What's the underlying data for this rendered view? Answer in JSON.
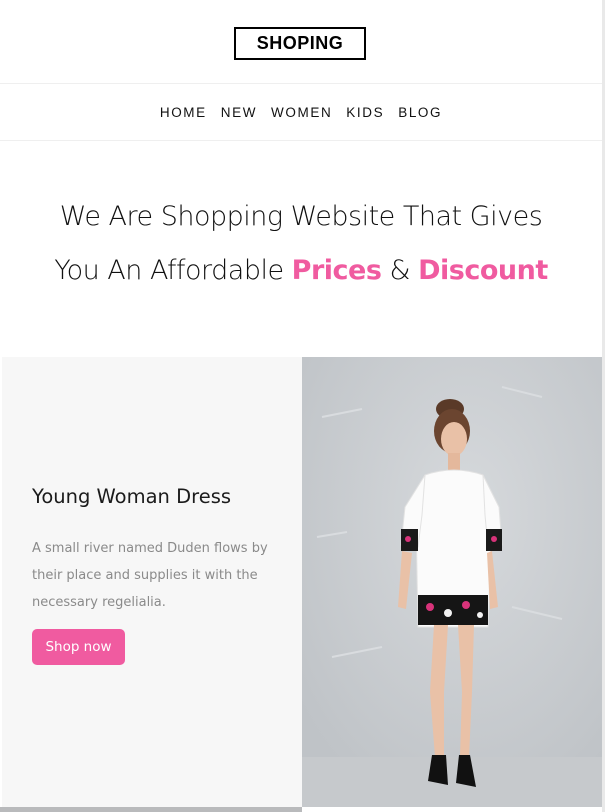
{
  "header": {
    "logo_text": "SHOPING"
  },
  "nav": {
    "items": [
      "HOME",
      "NEW",
      "WOMEN",
      "KIDS",
      "BLOG"
    ]
  },
  "hero": {
    "line1": "We Are Shopping Website That Gives",
    "line2_prefix": "You An Affordable ",
    "highlight1": "Prices",
    "connector": " & ",
    "highlight2": "Discount"
  },
  "product": {
    "title": "Young Woman Dress",
    "description": "A small river named Duden flows by their place and supplies it with the necessary regelialia.",
    "button_label": "Shop now"
  },
  "colors": {
    "accent": "#f05ba0",
    "text": "#111111",
    "muted": "#8a8a8a",
    "panel": "#f7f7f7"
  }
}
